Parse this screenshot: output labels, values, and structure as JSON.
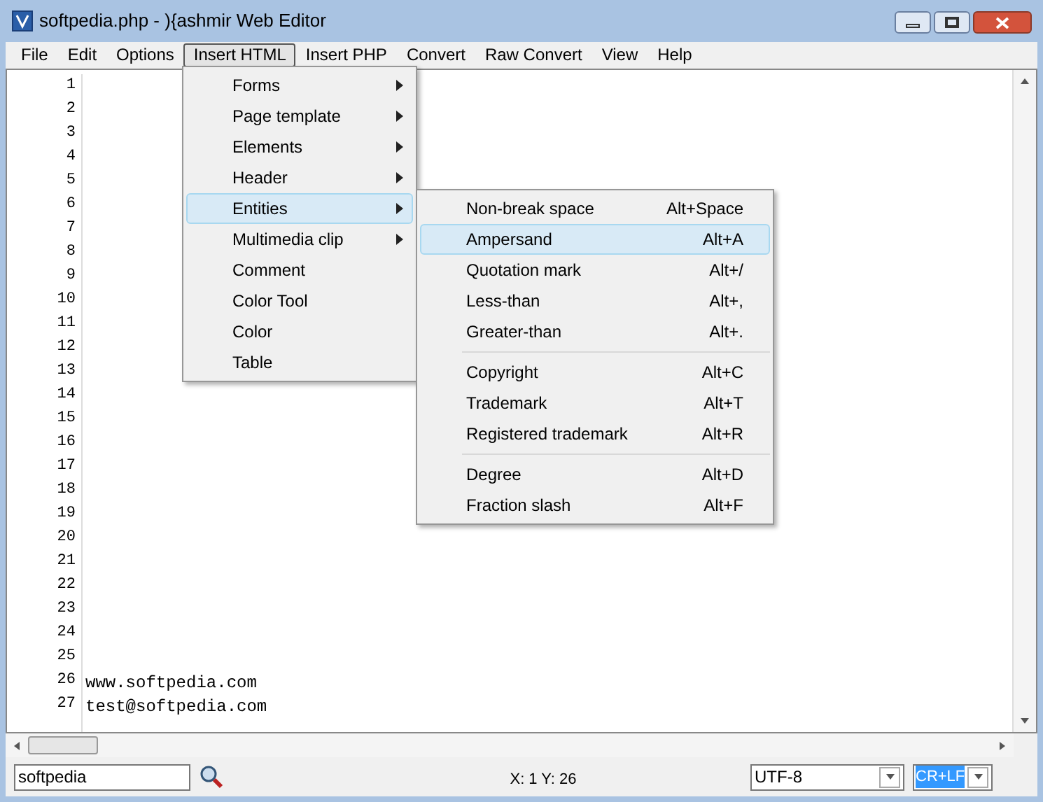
{
  "window": {
    "title": "softpedia.php - ){ashmir Web Editor"
  },
  "menu_bar": [
    {
      "label": "File",
      "selected": false
    },
    {
      "label": "Edit",
      "selected": false
    },
    {
      "label": "Options",
      "selected": false
    },
    {
      "label": "Insert HTML",
      "selected": true
    },
    {
      "label": "Insert PHP",
      "selected": false
    },
    {
      "label": "Convert",
      "selected": false
    },
    {
      "label": "Raw Convert",
      "selected": false
    },
    {
      "label": "View",
      "selected": false
    },
    {
      "label": "Help",
      "selected": false
    }
  ],
  "menu": [
    {
      "label": "Forms",
      "submenu": true,
      "selected": false
    },
    {
      "label": "Page template",
      "submenu": true,
      "selected": false
    },
    {
      "label": "Elements",
      "submenu": true,
      "selected": false
    },
    {
      "label": "Header",
      "submenu": true,
      "selected": false
    },
    {
      "label": "Entities",
      "submenu": true,
      "selected": true
    },
    {
      "label": "Multimedia clip",
      "submenu": true,
      "selected": false
    },
    {
      "label": "Comment",
      "submenu": false,
      "selected": false
    },
    {
      "label": "Color Tool",
      "submenu": false,
      "selected": false
    },
    {
      "label": "Color",
      "submenu": false,
      "selected": false
    },
    {
      "label": "Table",
      "submenu": false,
      "selected": false
    }
  ],
  "submenu": [
    [
      {
        "label": "Non-break space",
        "shortcut": "Alt+Space",
        "selected": false
      },
      {
        "label": "Ampersand",
        "shortcut": "Alt+A",
        "selected": true
      },
      {
        "label": "Quotation mark",
        "shortcut": "Alt+/",
        "selected": false
      },
      {
        "label": "Less-than",
        "shortcut": "Alt+,",
        "selected": false
      },
      {
        "label": "Greater-than",
        "shortcut": "Alt+.",
        "selected": false
      }
    ],
    [
      {
        "label": "Copyright",
        "shortcut": "Alt+C",
        "selected": false
      },
      {
        "label": "Trademark",
        "shortcut": "Alt+T",
        "selected": false
      },
      {
        "label": "Registered trademark",
        "shortcut": "Alt+R",
        "selected": false
      }
    ],
    [
      {
        "label": "Degree",
        "shortcut": "Alt+D",
        "selected": false
      },
      {
        "label": "Fraction slash",
        "shortcut": "Alt+F",
        "selected": false
      }
    ]
  ],
  "editor": {
    "lines": [
      {
        "number": "1"
      },
      {
        "number": "2"
      },
      {
        "number": "3"
      },
      {
        "number": "4"
      },
      {
        "number": "5"
      },
      {
        "number": "6"
      },
      {
        "number": "7"
      },
      {
        "number": "8"
      },
      {
        "number": "9"
      },
      {
        "number": "10"
      },
      {
        "number": "11"
      },
      {
        "number": "12"
      },
      {
        "number": "13"
      },
      {
        "number": "14"
      },
      {
        "number": "15"
      },
      {
        "number": "16"
      },
      {
        "number": "17"
      },
      {
        "number": "18"
      },
      {
        "number": "19"
      },
      {
        "number": "20"
      },
      {
        "number": "21"
      },
      {
        "number": "22"
      },
      {
        "number": "23"
      },
      {
        "number": "24"
      },
      {
        "number": "25"
      },
      {
        "number": "26",
        "text": "www.softpedia.com"
      },
      {
        "number": "27",
        "text": "test@softpedia.com"
      }
    ]
  },
  "status_bar": {
    "search": "softpedia",
    "position": "X: 1 Y: 26",
    "encoding": "UTF-8",
    "line_ending": "CR+LF"
  }
}
